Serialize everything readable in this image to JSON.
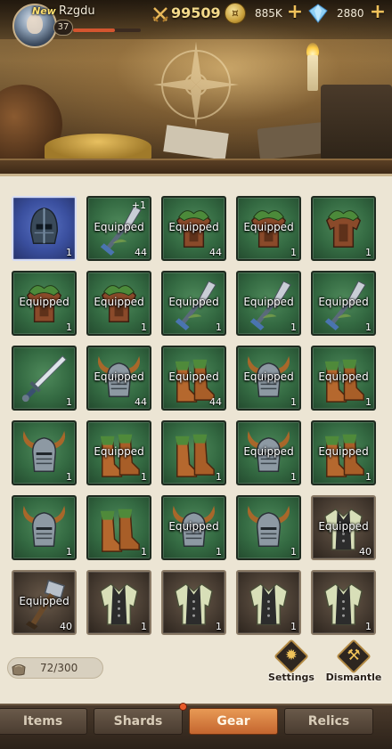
{
  "player": {
    "new_tag": "New",
    "name": "Rzgdu",
    "level": "37",
    "hp_fraction": 0.62
  },
  "resources": {
    "power": "99509",
    "gold": "885K",
    "gems": "2880"
  },
  "inventory": {
    "capacity": "72/300",
    "equipped_label": "Equipped",
    "rows": [
      [
        {
          "kind": "helmet",
          "rarity": "blue",
          "equipped": false,
          "count": "1"
        },
        {
          "kind": "shovel",
          "rarity": "green",
          "equipped": true,
          "count": "44",
          "plus": "+1"
        },
        {
          "kind": "armor",
          "rarity": "green",
          "equipped": true,
          "count": "44"
        },
        {
          "kind": "armor",
          "rarity": "green",
          "equipped": true,
          "count": "1"
        },
        {
          "kind": "armor",
          "rarity": "green",
          "equipped": false,
          "count": "1"
        }
      ],
      [
        {
          "kind": "armor",
          "rarity": "green",
          "equipped": true,
          "count": "1"
        },
        {
          "kind": "armor",
          "rarity": "green",
          "equipped": true,
          "count": "1"
        },
        {
          "kind": "shovel",
          "rarity": "green",
          "equipped": true,
          "count": "1"
        },
        {
          "kind": "shovel",
          "rarity": "green",
          "equipped": true,
          "count": "1"
        },
        {
          "kind": "shovel",
          "rarity": "green",
          "equipped": true,
          "count": "1"
        }
      ],
      [
        {
          "kind": "sword",
          "rarity": "green",
          "equipped": false,
          "count": "1"
        },
        {
          "kind": "horned-helm",
          "rarity": "green",
          "equipped": true,
          "count": "44"
        },
        {
          "kind": "boots",
          "rarity": "green",
          "equipped": true,
          "count": "44"
        },
        {
          "kind": "horned-helm",
          "rarity": "green",
          "equipped": true,
          "count": "1"
        },
        {
          "kind": "boots",
          "rarity": "green",
          "equipped": true,
          "count": "1"
        }
      ],
      [
        {
          "kind": "horned-helm",
          "rarity": "green",
          "equipped": false,
          "count": "1"
        },
        {
          "kind": "boots",
          "rarity": "green",
          "equipped": true,
          "count": "1"
        },
        {
          "kind": "boots",
          "rarity": "green",
          "equipped": false,
          "count": "1"
        },
        {
          "kind": "horned-helm",
          "rarity": "green",
          "equipped": true,
          "count": "1"
        },
        {
          "kind": "boots",
          "rarity": "green",
          "equipped": true,
          "count": "1"
        }
      ],
      [
        {
          "kind": "horned-helm",
          "rarity": "green",
          "equipped": false,
          "count": "1"
        },
        {
          "kind": "boots",
          "rarity": "green",
          "equipped": false,
          "count": "1"
        },
        {
          "kind": "horned-helm",
          "rarity": "green",
          "equipped": true,
          "count": "1"
        },
        {
          "kind": "horned-helm",
          "rarity": "green",
          "equipped": false,
          "count": "1"
        },
        {
          "kind": "vest",
          "rarity": "dark",
          "equipped": true,
          "count": "40"
        }
      ],
      [
        {
          "kind": "hammer",
          "rarity": "dark",
          "equipped": true,
          "count": "40"
        },
        {
          "kind": "vest",
          "rarity": "dark",
          "equipped": false,
          "count": "1"
        },
        {
          "kind": "vest",
          "rarity": "dark",
          "equipped": false,
          "count": "1"
        },
        {
          "kind": "vest",
          "rarity": "dark",
          "equipped": false,
          "count": "1"
        },
        {
          "kind": "vest",
          "rarity": "dark",
          "equipped": false,
          "count": "1"
        }
      ]
    ]
  },
  "actions": {
    "settings_label": "Settings",
    "dismantle_label": "Dismantle"
  },
  "tabs": [
    {
      "label": "Items",
      "active": false
    },
    {
      "label": "Shards",
      "active": false
    },
    {
      "label": "Gear",
      "active": true
    },
    {
      "label": "Relics",
      "active": false
    }
  ],
  "colors": {
    "slot_green": "#346a42",
    "slot_blue": "#3a4f9e",
    "slot_dark": "#453a30",
    "tab_active": "#d97b3e",
    "panel_bg": "#ece5d4"
  }
}
